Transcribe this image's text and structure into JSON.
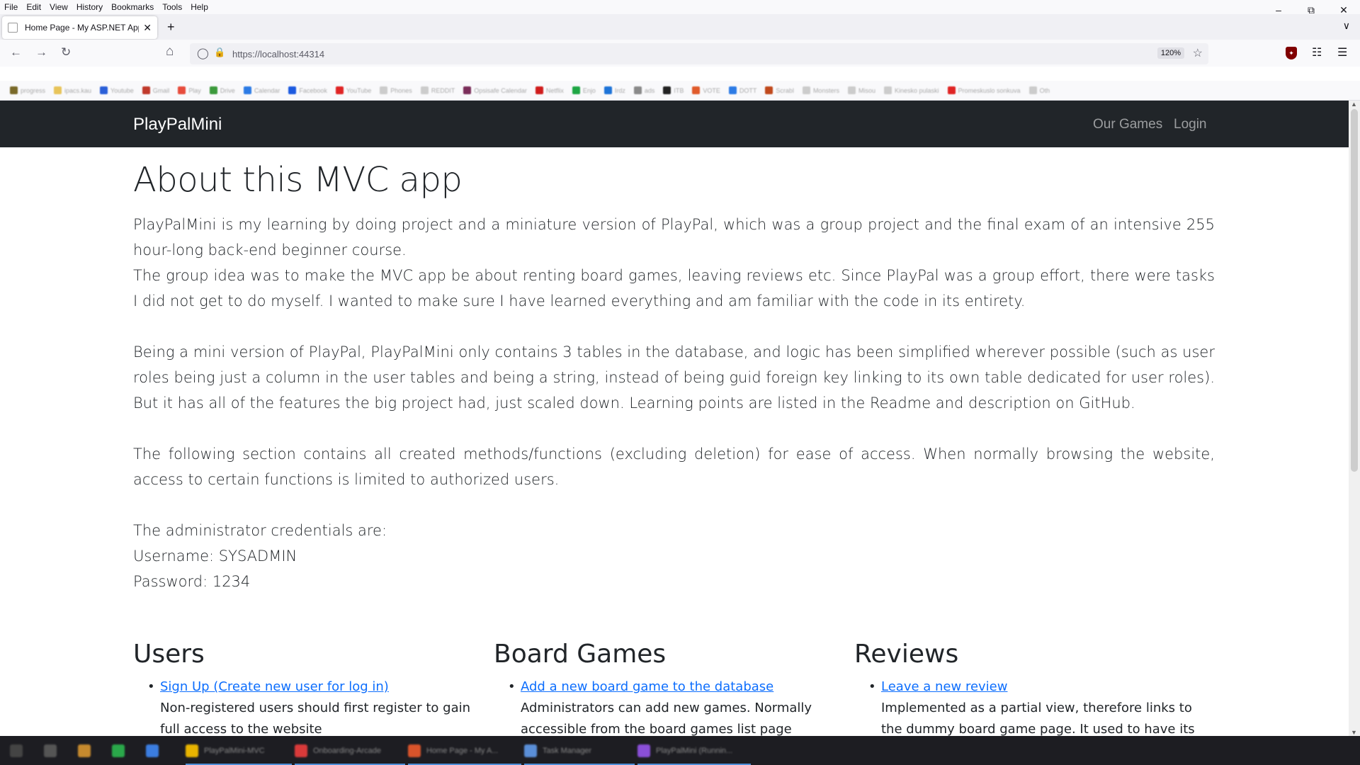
{
  "menu": [
    "File",
    "Edit",
    "View",
    "History",
    "Bookmarks",
    "Tools",
    "Help"
  ],
  "window_controls": [
    "–",
    "⧉",
    "✕"
  ],
  "tab": {
    "title": "Home Page - My ASP.NET App",
    "close": "✕"
  },
  "new_tab": "+",
  "list_tabs": "∨",
  "toolbar": {
    "back": "←",
    "forward": "→",
    "reload": "↻",
    "home": "⌂",
    "url": "https://localhost:44314",
    "zoom": "120%"
  },
  "bookmarks": [
    {
      "label": "progress",
      "color": "#7a6a2a"
    },
    {
      "label": "ipacs.kau",
      "color": "#e8c45a"
    },
    {
      "label": "Youtube",
      "color": "#2b5fd8"
    },
    {
      "label": "Gmail",
      "color": "#c0392b"
    },
    {
      "label": "Play",
      "color": "#e74c3c"
    },
    {
      "label": "Drive",
      "color": "#3c9a3c"
    },
    {
      "label": "Calendar",
      "color": "#2c7be5"
    },
    {
      "label": "Facebook",
      "color": "#1c5ae0"
    },
    {
      "label": "YouTube",
      "color": "#e02424"
    },
    {
      "label": "Phones",
      "color": "#cccccc"
    },
    {
      "label": "REDDIT",
      "color": "#cccccc"
    },
    {
      "label": "Opsisafe Calendar",
      "color": "#7b2e5a"
    },
    {
      "label": "Netflix",
      "color": "#d01c1c"
    },
    {
      "label": "Enjo",
      "color": "#1ea644"
    },
    {
      "label": "Irdz",
      "color": "#1e74d8"
    },
    {
      "label": "ads",
      "color": "#8a8a8a"
    },
    {
      "label": "ITB",
      "color": "#222222"
    },
    {
      "label": "VOTE",
      "color": "#e05b2b"
    },
    {
      "label": "DOTT",
      "color": "#2c7be5"
    },
    {
      "label": "Scrabl",
      "color": "#c0491c"
    },
    {
      "label": "Monsters",
      "color": "#cccccc"
    },
    {
      "label": "Misou",
      "color": "#cccccc"
    },
    {
      "label": "Kinesko pulaski",
      "color": "#cccccc"
    },
    {
      "label": "Promeskuslo sonkuva",
      "color": "#e02424"
    },
    {
      "label": "Oth",
      "color": "#cccccc"
    }
  ],
  "site": {
    "brand": "PlayPalMini",
    "nav": [
      "Our Games",
      "Login"
    ],
    "heading": "About this MVC app",
    "paragraphs": [
      "PlayPalMini is my learning by doing project and a miniature version of PlayPal, which was a group project and the final exam of an intensive 255 hour-long back-end beginner course.",
      "The group idea was to make the MVC app be about renting board games, leaving reviews etc. Since PlayPal was a group effort, there were tasks I did not get to do myself. I wanted to make sure I have learned everything and am familiar with the code in its entirety.",
      "Being a mini version of PlayPal, PlayPalMini only contains 3 tables in the database, and logic has been simplified wherever possible (such as user roles being just a column in the user tables and being a string, instead of being guid foreign key linking to its own table dedicated for user roles). But it has all of the features the big project had, just scaled down. Learning points are listed in the Readme and description on GitHub.",
      "The following section contains all created methods/functions (excluding deletion) for ease of access. When normally browsing the website, access to certain functions is limited to authorized users."
    ],
    "credentials": [
      "The administrator credentials are:",
      "Username: SYSADMIN",
      "Password: 1234"
    ],
    "sections": [
      {
        "title": "Users",
        "link": "Sign Up (Create new user for log in)",
        "desc": "Non-registered users should first register to gain full access to the website"
      },
      {
        "title": "Board Games",
        "link": "Add a new board game to the database",
        "desc": "Administrators can add new games. Normally accessible from the board games list page"
      },
      {
        "title": "Reviews",
        "link": "Leave a new review",
        "desc": "Implemented as a partial view, therefore links to the dummy board game page. It used to have its own"
      }
    ]
  },
  "taskbar": [
    {
      "label": "",
      "color": "#444"
    },
    {
      "label": "",
      "color": "#555"
    },
    {
      "label": "",
      "color": "#c68a2e"
    },
    {
      "label": "",
      "color": "#2aa84a"
    },
    {
      "label": "",
      "color": "#3b7de0"
    },
    {
      "label": "PlayPalMini-MVC",
      "color": "#e8b400"
    },
    {
      "label": "Onboarding-Arcade",
      "color": "#d93a3a"
    },
    {
      "label": "Home Page - My A...",
      "color": "#d9542b"
    },
    {
      "label": "Task Manager",
      "color": "#5a8fd8"
    },
    {
      "label": "PlayPalMini (Runnin...",
      "color": "#8a4fd8"
    }
  ]
}
